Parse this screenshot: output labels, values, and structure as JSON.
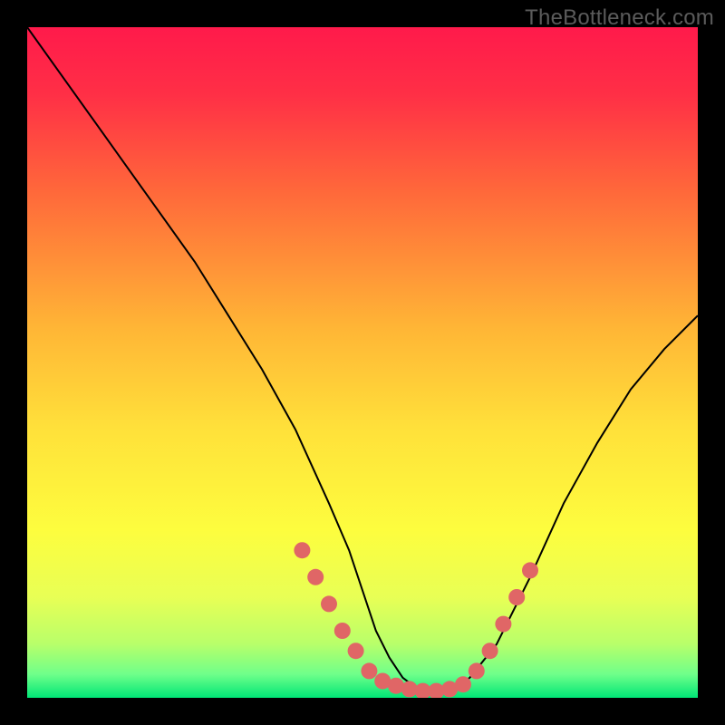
{
  "watermark": "TheBottleneck.com",
  "colors": {
    "frame": "#000000",
    "curve": "#000000",
    "dots": "#e06666",
    "gradient_stops": [
      {
        "offset": 0.0,
        "color": "#ff1a4b"
      },
      {
        "offset": 0.1,
        "color": "#ff2f46"
      },
      {
        "offset": 0.25,
        "color": "#ff6a3a"
      },
      {
        "offset": 0.45,
        "color": "#ffb636"
      },
      {
        "offset": 0.6,
        "color": "#ffe13a"
      },
      {
        "offset": 0.75,
        "color": "#fdfd3e"
      },
      {
        "offset": 0.85,
        "color": "#e8ff55"
      },
      {
        "offset": 0.92,
        "color": "#b8ff6a"
      },
      {
        "offset": 0.965,
        "color": "#6fff8a"
      },
      {
        "offset": 1.0,
        "color": "#00e676"
      }
    ]
  },
  "chart_data": {
    "type": "line",
    "title": "",
    "xlabel": "",
    "ylabel": "",
    "xlim": [
      0,
      100
    ],
    "ylim": [
      0,
      100
    ],
    "series": [
      {
        "name": "bottleneck-curve",
        "x": [
          0,
          5,
          10,
          15,
          20,
          25,
          30,
          35,
          40,
          45,
          48,
          50,
          52,
          54,
          56,
          58,
          60,
          62,
          64,
          66,
          70,
          75,
          80,
          85,
          90,
          95,
          100
        ],
        "y": [
          100,
          93,
          86,
          79,
          72,
          65,
          57,
          49,
          40,
          29,
          22,
          16,
          10,
          6,
          3,
          1.5,
          1,
          1,
          1.5,
          3,
          8,
          18,
          29,
          38,
          46,
          52,
          57
        ]
      }
    ],
    "dots": {
      "name": "highlighted-points",
      "x": [
        41,
        43,
        45,
        47,
        49,
        51,
        53,
        55,
        57,
        59,
        61,
        63,
        65,
        67,
        69,
        71,
        73,
        75
      ],
      "y": [
        22,
        18,
        14,
        10,
        7,
        4,
        2.5,
        1.8,
        1.3,
        1,
        1,
        1.3,
        2,
        4,
        7,
        11,
        15,
        19
      ]
    }
  }
}
